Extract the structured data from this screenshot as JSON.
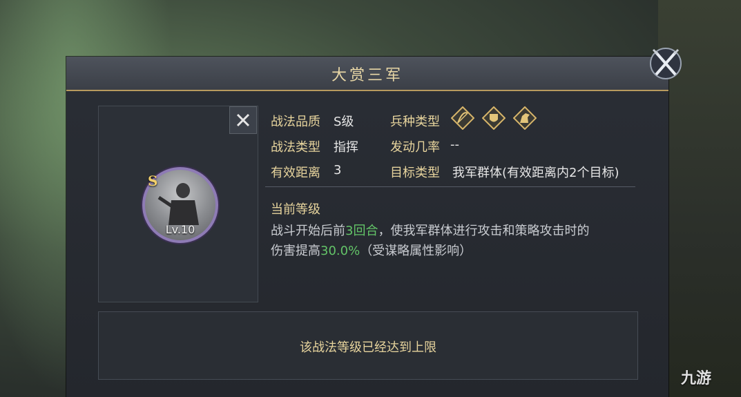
{
  "title": "大赏三军",
  "skill": {
    "grade": "S",
    "level": "Lv.10",
    "rows_left": [
      {
        "label": "战法品质",
        "value": "S级"
      },
      {
        "label": "战法类型",
        "value": "指挥"
      },
      {
        "label": "有效距离",
        "value": "3"
      }
    ],
    "rows_right": [
      {
        "label": "兵种类型",
        "value": ""
      },
      {
        "label": "发动几率",
        "value": "--"
      },
      {
        "label": "目标类型",
        "value": "我军群体(有效距离内2个目标)"
      }
    ],
    "unit_icons": [
      "bow-icon",
      "shield-icon",
      "horse-icon"
    ]
  },
  "current_level": {
    "title": "当前等级",
    "line1_a": "战斗开始后前",
    "line1_hl": "3回合",
    "line1_b": "，使我军群体进行攻击和策略攻击时的",
    "line2_a": "伤害提高",
    "line2_hl": "30.0%",
    "line2_b": "（受谋略属性影响）"
  },
  "max_level_text": "该战法等级已经达到上限",
  "watermark": "九游",
  "colors": {
    "label": "#e7d49d",
    "highlight": "#63c468",
    "frame": "#8e7bb5"
  }
}
